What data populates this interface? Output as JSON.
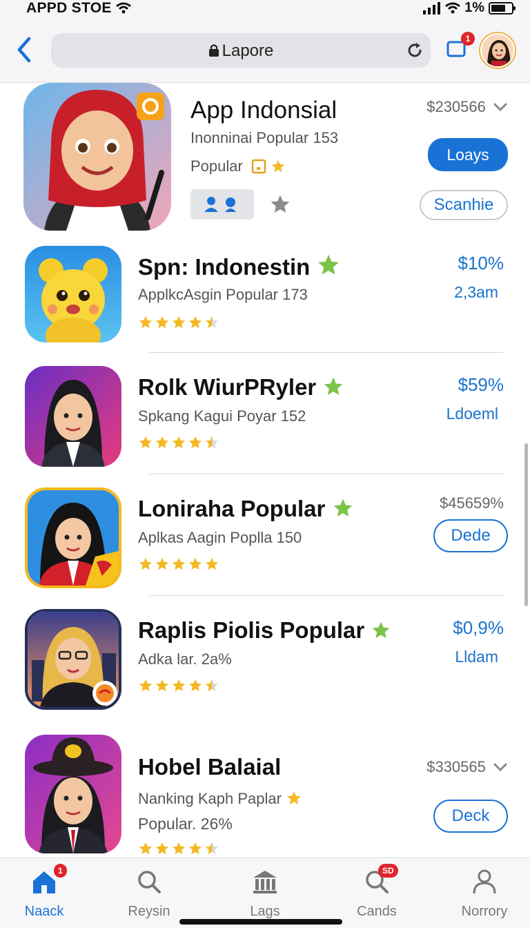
{
  "status": {
    "carrier": "APPD STOE",
    "battery_text": "1%"
  },
  "header": {
    "url": "Lapore",
    "notif_count": "1"
  },
  "apps": [
    {
      "title": "App Indonsial",
      "subtitle": "Inonninai Popular 153",
      "tag": "Popular",
      "price": "$230566",
      "get_label": "Loays",
      "secondary_label": "Scanhie"
    },
    {
      "title": "Spn: Indonestin",
      "subtitle": "ApplkcAsgin Popular 173",
      "price": "$10%",
      "meta": "2,3am",
      "rating": 4.5
    },
    {
      "title": "Rolk WiurPRyler",
      "subtitle": "Spkang Kagui Poyar 152",
      "price": "$59%",
      "meta": "Ldoeml",
      "rating": 4.5
    },
    {
      "title": "Loniraha Popular",
      "subtitle": "Aplkas Aagin Poplla 150",
      "price": "$45659%",
      "button": "Dede",
      "rating": 5
    },
    {
      "title": "Raplis Piolis Popular",
      "subtitle": "Adka lar. 2a%",
      "price": "$0,9%",
      "meta": "Lldam",
      "rating": 4.5
    },
    {
      "title": "Hobel Balaial",
      "subtitle": "Nanking Kaph Paplar",
      "subtitle2": "Popular. 26%",
      "price": "$330565",
      "button": "Deck",
      "rating": 4.5
    }
  ],
  "tabs": [
    {
      "label": "Naack",
      "badge": "1"
    },
    {
      "label": "Reysin"
    },
    {
      "label": "Lags"
    },
    {
      "label": "Cands",
      "badge": "SD"
    },
    {
      "label": "Norrory"
    }
  ],
  "colors": {
    "accent": "#1a72d6",
    "star": "#f4b824",
    "badge": "#e0242b"
  }
}
